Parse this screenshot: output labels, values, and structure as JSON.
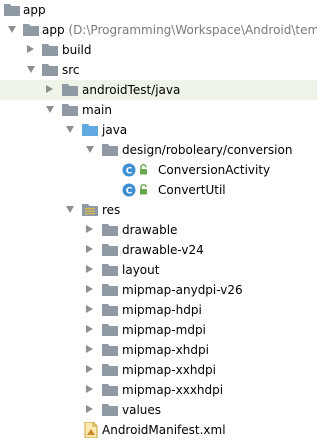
{
  "panel": {
    "root": "app",
    "module": {
      "name": "app",
      "path": " (D:\\Programming\\Workspace\\Android\\tempera"
    },
    "items": {
      "build": "build",
      "src": "src",
      "android_test": "androidTest/java",
      "main": "main",
      "java": "java",
      "package": "design/roboleary/conversion",
      "class1": "ConversionActivity",
      "class2": "ConvertUtil",
      "res": "res",
      "drawable": "drawable",
      "drawable_v24": "drawable-v24",
      "layout": "layout",
      "mipmap_anydpi": "mipmap-anydpi-v26",
      "mipmap_hdpi": "mipmap-hdpi",
      "mipmap_mdpi": "mipmap-mdpi",
      "mipmap_xhdpi": "mipmap-xhdpi",
      "mipmap_xxhdpi": "mipmap-xxhdpi",
      "mipmap_xxxhdpi": "mipmap-xxxhdpi",
      "values": "values",
      "manifest": "AndroidManifest.xml"
    },
    "class_badge_letter": "C",
    "colors": {
      "folder": "#8f9aa5",
      "source_folder": "#5fa9e0",
      "class_badge": "#3d8ed3",
      "lock": "#6aa84f"
    }
  }
}
